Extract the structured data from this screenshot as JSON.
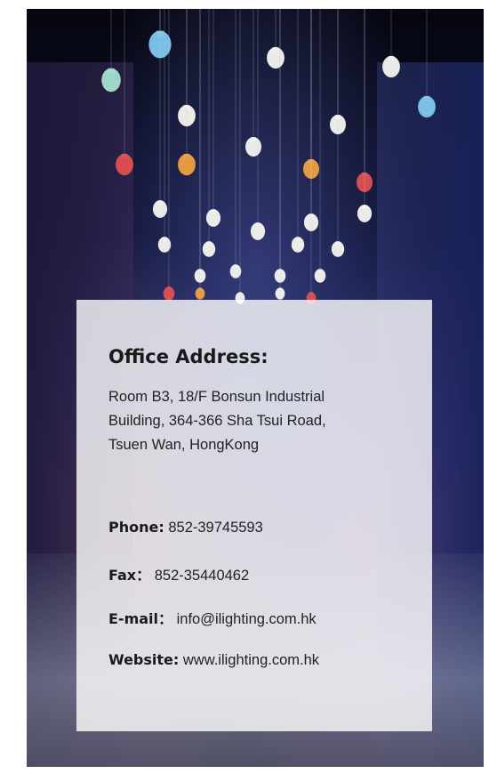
{
  "card": {
    "heading": "Office Address:",
    "address_lines": [
      "Room B3, 18/F Bonsun Industrial",
      "Building, 364-366 Sha Tsui Road,",
      "Tsuen Wan, HongKong"
    ],
    "contacts": [
      {
        "label": "Phone:",
        "value": "852-39745593"
      },
      {
        "label": "Fax：",
        "value": "852-35440462"
      },
      {
        "label": "E-mail：",
        "value": "info@ilighting.com.hk"
      },
      {
        "label": "Website:",
        "value": "www.ilighting.com.hk"
      }
    ]
  },
  "background": {
    "scene": "night street with hanging colored light bulbs",
    "bulb_colors": [
      "#7ec8f0",
      "#a8e0d0",
      "#f5f5f0",
      "#f0a040",
      "#e05050"
    ]
  }
}
